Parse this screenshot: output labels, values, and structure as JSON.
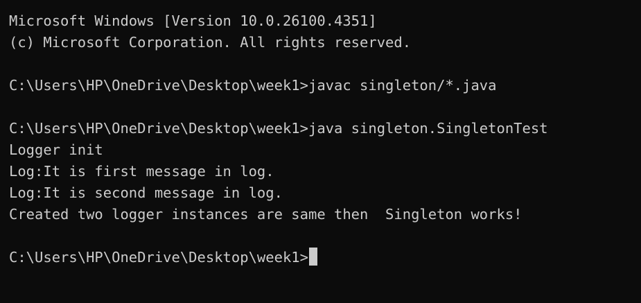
{
  "terminal": {
    "colors": {
      "background": "#0c0c0c",
      "foreground": "#cccccc"
    },
    "lines": [
      "Microsoft Windows [Version 10.0.26100.4351]",
      "(c) Microsoft Corporation. All rights reserved.",
      "",
      "C:\\Users\\HP\\OneDrive\\Desktop\\week1>javac singleton/*.java",
      "",
      "C:\\Users\\HP\\OneDrive\\Desktop\\week1>java singleton.SingletonTest",
      "Logger init",
      "Log:It is first message in log.",
      "Log:It is second message in log.",
      "Created two logger instances are same then  Singleton works!",
      ""
    ],
    "prompt": "C:\\Users\\HP\\OneDrive\\Desktop\\week1>"
  }
}
